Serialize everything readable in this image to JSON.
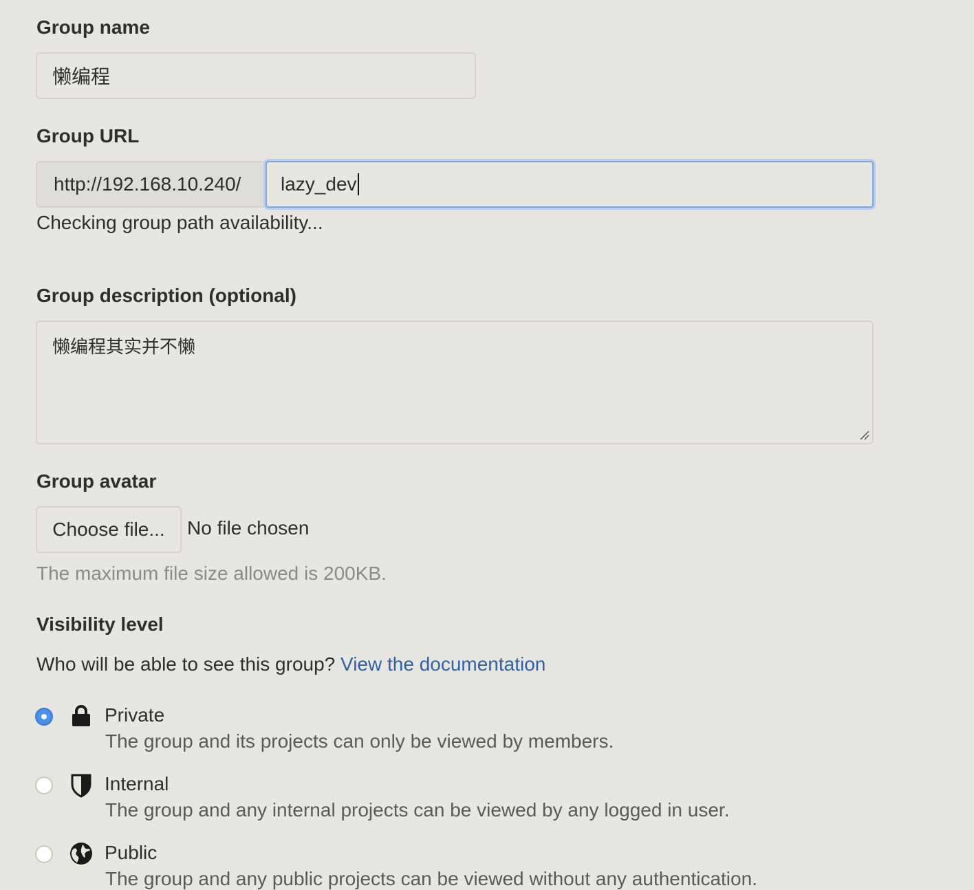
{
  "group_name": {
    "label": "Group name",
    "value": "懒编程"
  },
  "group_url": {
    "label": "Group URL",
    "prefix": "http://192.168.10.240/",
    "value": "lazy_dev",
    "status": "Checking group path availability..."
  },
  "group_description": {
    "label": "Group description (optional)",
    "value": "懒编程其实并不懒"
  },
  "group_avatar": {
    "label": "Group avatar",
    "button_label": "Choose file...",
    "file_status": "No file chosen",
    "help": "The maximum file size allowed is 200KB."
  },
  "visibility": {
    "label": "Visibility level",
    "question": "Who will be able to see this group?",
    "doc_link": "View the documentation",
    "options": [
      {
        "title": "Private",
        "desc": "The group and its projects can only be viewed by members.",
        "icon": "lock-icon",
        "selected": true
      },
      {
        "title": "Internal",
        "desc": "The group and any internal projects can be viewed by any logged in user.",
        "icon": "shield-icon",
        "selected": false
      },
      {
        "title": "Public",
        "desc": "The group and any public projects can be viewed without any authentication.",
        "icon": "globe-icon",
        "selected": false
      }
    ]
  },
  "colors": {
    "link": "#2f62a6",
    "focus": "#7aa7e8",
    "radio_selected": "#4a8fe9",
    "background": "#e8e6e1"
  }
}
